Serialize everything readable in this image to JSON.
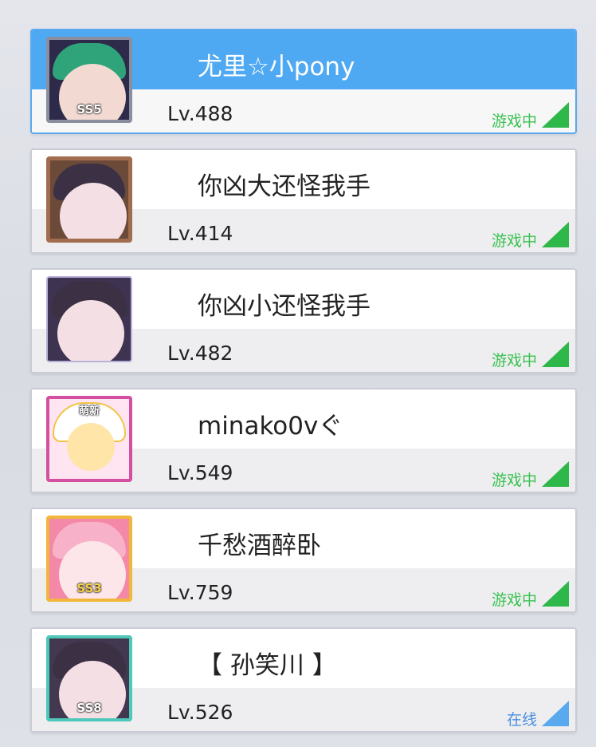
{
  "friends": [
    {
      "name": "尤里☆小pony",
      "level": "Lv.488",
      "status": "游戏中",
      "avatar_badge": "SS5",
      "selected": true
    },
    {
      "name": "你凶大还怪我手",
      "level": "Lv.414",
      "status": "游戏中",
      "avatar_badge": ""
    },
    {
      "name": "你凶小还怪我手",
      "level": "Lv.482",
      "status": "游戏中",
      "avatar_badge": ""
    },
    {
      "name": "minako0vぐ",
      "level": "Lv.549",
      "status": "游戏中",
      "avatar_badge": "萌新"
    },
    {
      "name": "千愁酒醉卧",
      "level": "Lv.759",
      "status": "游戏中",
      "avatar_badge": "SS3"
    },
    {
      "name": "【 孙笑川 】",
      "level": "Lv.526",
      "status": "在线",
      "avatar_badge": "SS8"
    }
  ],
  "colors": {
    "selected_bg": "#4fa9f2",
    "in_game": "#39c24f",
    "online": "#4a8fe0"
  },
  "icons": {
    "signal": "signal-strength-icon"
  }
}
